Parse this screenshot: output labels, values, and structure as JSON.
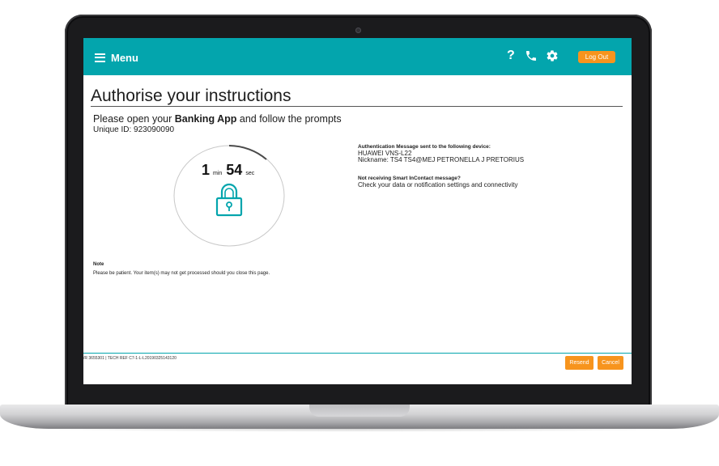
{
  "header": {
    "menu_label": "Menu",
    "help_icon": "?",
    "logout_label": "Log Out",
    "colors": {
      "bar": "#03a5ad",
      "accent": "#f7941d"
    }
  },
  "page": {
    "title": "Authorise your instructions",
    "instruction_prefix": "Please open your ",
    "instruction_bold": "Banking App",
    "instruction_suffix": " and follow the prompts",
    "unique_id": "Unique ID: 923090090"
  },
  "timer": {
    "minutes": "1",
    "minutes_unit": "min",
    "seconds": "54",
    "seconds_unit": "sec"
  },
  "auth": {
    "sent_label": "Authentication Message sent to the following device:",
    "device": "HUAWEI VNS-L22",
    "nickname": "Nickname: TS4 TS4@MEJ PETRONELLA J PRETORIUS",
    "not_receiving_label": "Not receiving Smart InContact message?",
    "not_receiving_text": "Check your data or notification settings and connectivity"
  },
  "note": {
    "label": "Note",
    "text": "Please be patient. Your item(s) may not get processed should you close this page."
  },
  "footer": {
    "ref": "/R 3655301 | TECH REF C7-1-L-L20190325143120",
    "resend_label": "Resend",
    "cancel_label": "Cancel"
  },
  "icons": [
    "menu-icon",
    "help-icon",
    "phone-icon",
    "gear-icon",
    "padlock-icon"
  ]
}
